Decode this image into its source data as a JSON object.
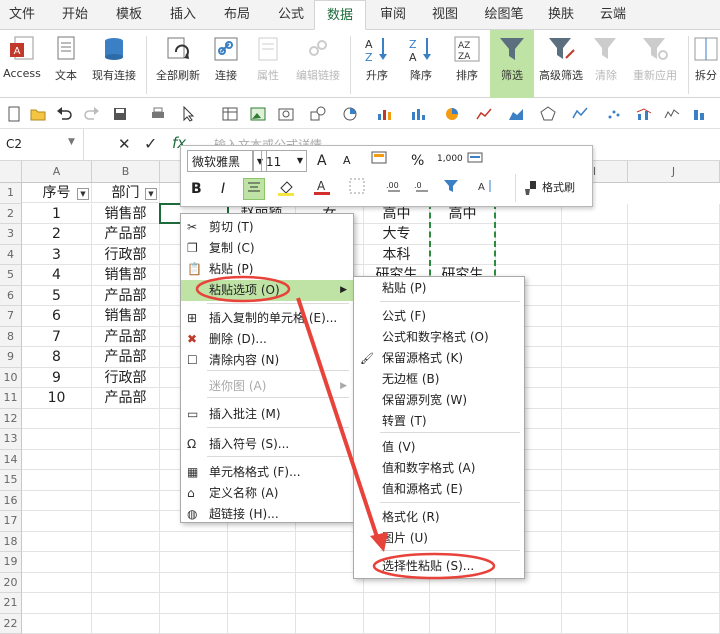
{
  "tabs": [
    "文件",
    "开始",
    "模板",
    "插入",
    "布局",
    "公式",
    "数据",
    "审阅",
    "视图",
    "绘图笔",
    "换肤",
    "云端"
  ],
  "ribbon": {
    "access": "Access",
    "text": "文本",
    "existing": "现有连接",
    "refresh_all": "全部刷新",
    "connections": "连接",
    "properties": "属性",
    "edit_links": "编辑链接",
    "asc": "升序",
    "desc": "降序",
    "sort": "排序",
    "filter": "筛选",
    "advanced": "高级筛选",
    "clear": "清除",
    "reapply": "重新应用",
    "split": "拆分"
  },
  "formula": {
    "namebox": "C2",
    "cancel": "✕",
    "confirm": "✓",
    "fx": "fx",
    "placeholder": "输入文本或公式详情。"
  },
  "columns": [
    "A",
    "B",
    "C",
    "D",
    "E",
    "F",
    "G",
    "H",
    "I",
    "J"
  ],
  "rows": [
    "1",
    "2",
    "3",
    "4",
    "5",
    "6",
    "7",
    "8",
    "9",
    "10",
    "11",
    "12",
    "13",
    "14",
    "15",
    "16",
    "17",
    "18",
    "19",
    "20",
    "21",
    "22"
  ],
  "headers": {
    "a": "序号",
    "b": "部门"
  },
  "table": [
    {
      "a": "1",
      "b": "销售部",
      "c": "",
      "d": "赵丽颖",
      "e": "女",
      "f": "高中",
      "g": "高中"
    },
    {
      "a": "2",
      "b": "产品部",
      "c": "7",
      "d": "",
      "e": "",
      "f": "大专",
      "g": ""
    },
    {
      "a": "3",
      "b": "行政部",
      "c": "7",
      "d": "",
      "e": "",
      "f": "本科",
      "g": ""
    },
    {
      "a": "4",
      "b": "销售部",
      "c": "",
      "d": "",
      "e": "",
      "f": "研究生",
      "g": "研究生"
    },
    {
      "a": "5",
      "b": "产品部",
      "c": "",
      "d": "",
      "e": "",
      "f": "",
      "g": ""
    },
    {
      "a": "6",
      "b": "销售部",
      "c": "",
      "d": "",
      "e": "",
      "f": "",
      "g": ""
    },
    {
      "a": "7",
      "b": "产品部",
      "c": "研",
      "d": "",
      "e": "",
      "f": "",
      "g": ""
    },
    {
      "a": "8",
      "b": "产品部",
      "c": "高",
      "d": "",
      "e": "",
      "f": "",
      "g": ""
    },
    {
      "a": "9",
      "b": "行政部",
      "c": "7",
      "d": "",
      "e": "",
      "f": "",
      "g": ""
    },
    {
      "a": "10",
      "b": "产品部",
      "c": "研",
      "d": "",
      "e": "",
      "f": "",
      "g": ""
    }
  ],
  "mini": {
    "font": "微软雅黑",
    "size": "11",
    "percent": "%",
    "thousands": "1,000",
    "bold": "B",
    "italic": "I",
    "brush": "格式刷",
    "grow": "A",
    "shrink": "A"
  },
  "context_menu": [
    {
      "label": "剪切 (T)",
      "icon": "scissors-icon"
    },
    {
      "label": "复制 (C)",
      "icon": "copy-icon"
    },
    {
      "label": "粘贴 (P)",
      "icon": "paste-icon"
    },
    {
      "label": "粘贴选项 (O)",
      "icon": "",
      "sub": true
    },
    {
      "label": "插入复制的单元格 (E)...",
      "icon": "insert-cells-icon"
    },
    {
      "label": "删除 (D)...",
      "icon": "delete-icon"
    },
    {
      "label": "清除内容 (N)",
      "icon": "clear-icon"
    },
    {
      "label": "迷你图 (A)",
      "icon": "",
      "sub": true
    },
    {
      "label": "插入批注 (M)",
      "icon": "comment-icon"
    },
    {
      "label": "插入符号 (S)...",
      "icon": "omega-icon"
    },
    {
      "label": "单元格格式 (F)...",
      "icon": "format-cells-icon"
    },
    {
      "label": "定义名称 (A)",
      "icon": "tag-icon"
    },
    {
      "label": "超链接 (H)...",
      "icon": "globe-icon"
    }
  ],
  "submenu": [
    "粘贴 (P)",
    "公式 (F)",
    "公式和数字格式 (O)",
    "保留源格式 (K)",
    "无边框 (B)",
    "保留源列宽 (W)",
    "转置 (T)",
    "值 (V)",
    "值和数字格式 (A)",
    "值和源格式 (E)",
    "格式化 (R)",
    "图片 (U)",
    "选择性粘贴 (S)..."
  ],
  "colors": {
    "accent": "#1d6b3a",
    "highlight": "#bfe3a4",
    "annotation": "#e8433a"
  }
}
